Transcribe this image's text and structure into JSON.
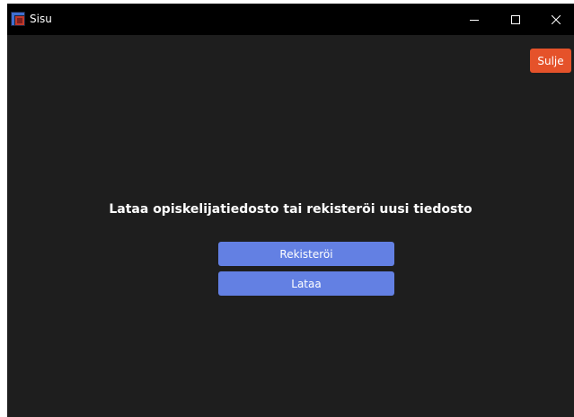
{
  "window": {
    "title": "Sisu",
    "app_icon": "sisu-app-icon",
    "controls": {
      "minimize_icon": "minimize-icon",
      "maximize_icon": "maximize-icon",
      "close_icon": "close-icon"
    }
  },
  "toolbar": {
    "close_label": "Sulje"
  },
  "main": {
    "heading": "Lataa opiskelijatiedosto tai rekisteröi uusi tiedosto",
    "register_label": "Rekisteröi",
    "load_label": "Lataa"
  },
  "colors": {
    "background": "#1e1e1e",
    "titlebar": "#000000",
    "primary_button": "#6380e3",
    "close_button": "#e5522a",
    "text": "#ffffff"
  }
}
